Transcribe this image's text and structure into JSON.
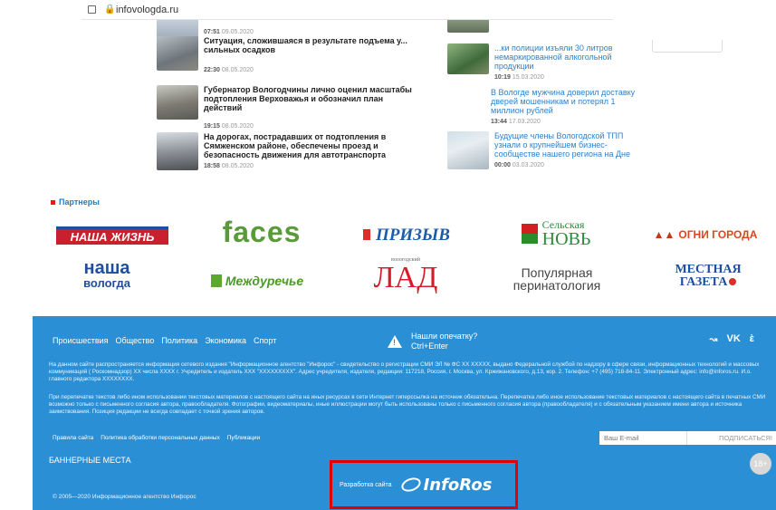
{
  "browser": {
    "url": "infovologda.ru"
  },
  "news_left": [
    {
      "title": "",
      "time": "07:51",
      "date": "09.05.2020"
    },
    {
      "title": "Ситуация, сложившаяся в результате подъема у... сильных осадков",
      "time": "22:30",
      "date": "08.05.2020"
    },
    {
      "title": "Губернатор Вологодчины лично оценил масштабы подтопления Верховажья и обозначил план действий",
      "time": "19:15",
      "date": "08.05.2020"
    },
    {
      "title": "На дорогах, пострадавших от подтопления в Сямженском районе, обеспечены проезд и безопасность движения для автотранспорта",
      "time": "18:58",
      "date": "08.05.2020"
    }
  ],
  "news_right": [
    {
      "title": "",
      "time": "",
      "date": ""
    },
    {
      "title": "...ки полиции изъяли 30 литров немаркированной алкогольной продукции",
      "time": "10:19",
      "date": "15.03.2020"
    },
    {
      "title": "В Вологде мужчина доверил доставку дверей мошенникам и потерял 1 миллион рублей",
      "time": "13:44",
      "date": "17.03.2020"
    },
    {
      "title": "Будущие члены Вологодской ТПП узнали о крупнейшем бизнес-сообществе нашего региона на Дне",
      "time": "00:00",
      "date": "03.03.2020"
    }
  ],
  "partners": {
    "title": "Партнеры",
    "logos": {
      "nasha_zhizn": "НАША ЖИЗНЬ",
      "faces": "faces",
      "prizyv": "ПРИЗЫВ",
      "selskaya_nov_1": "Сельская",
      "selskaya_nov_2": "НОВЬ",
      "ogni_goroda": "ОГНИ ГОРОДА",
      "nasha_vologda_1": "наша",
      "nasha_vologda_2": "вологда",
      "mezhdurechye": "Междуречье",
      "lad_small": "вологодский",
      "lad": "ЛАД",
      "populyarnaya_1": "Популярная",
      "populyarnaya_2": "перинатология",
      "mestnaya_1": "МЕСТНАЯ",
      "mestnaya_2": "ГАЗЕТА"
    }
  },
  "footer": {
    "nav": [
      "Происшествия",
      "Общество",
      "Политика",
      "Экономика",
      "Спорт"
    ],
    "typo_line1": "Нашли опечатку?",
    "typo_line2": "Ctrl+Enter",
    "social": {
      "rss": "↝",
      "vk": "VK",
      "ok": "ὲ"
    },
    "legal1": "На данном сайте распространяется информация сетевого издания \"Информационное агентство \"Инфорос\" - свидетельство о регистрации СМИ ЭЛ № ФС XX XXXXX, выдано Федеральной службой по надзору в сфере связи, информационных технологий и массовых коммуникаций ( Роскомнадзор) XX числа XXXX г. Учредитель и издатель XXX \"XXXXXXXXX\". Адрес учредителя, издателя, редакции: 117218, Россия, г. Москва, ул. Кржижановского, д.13, кор. 2. Телефон: +7 (495) 718-84-11. Электронный адрес: info@inforos.ru. И.о. главного редактора XXXXXXXX.",
    "legal2": "При перепечатке текстов либо ином использовании текстовых материалов с настоящего сайта на иных ресурсах в сети Интернет гиперссылка на источник обязательна. Перепечатка либо иное использование текстовых материалов с настоящего сайта в печатных СМИ возможно только с письменного согласия автора, правообладателя. Фотографии, видеоматериалы, иные иллюстрации могут быть использованы только с письменного согласия автора (правообладателя) и с обязательным указанием имени автора и источника заимствования. Позиция редакции не всегда совпадает с точкой зрения авторов.",
    "links": [
      "Правила сайта",
      "Политика обработки персональных данных",
      "Публикации"
    ],
    "email_placeholder": "Ваш E-mail",
    "subscribe": "ПОДПИСАТЬСЯ!",
    "banners": "БАННЕРНЫЕ МЕСТА",
    "copyright": "© 2005—2020 Информационное агентство Инфорос",
    "dev_label": "Разработка сайта",
    "dev_brand": "InfoRos",
    "age": "18+"
  },
  "colors": {
    "footer": "#2b8fd5",
    "highlight": "#e00000",
    "link": "#2e7fc9",
    "accent_red": "#e21c1c"
  }
}
